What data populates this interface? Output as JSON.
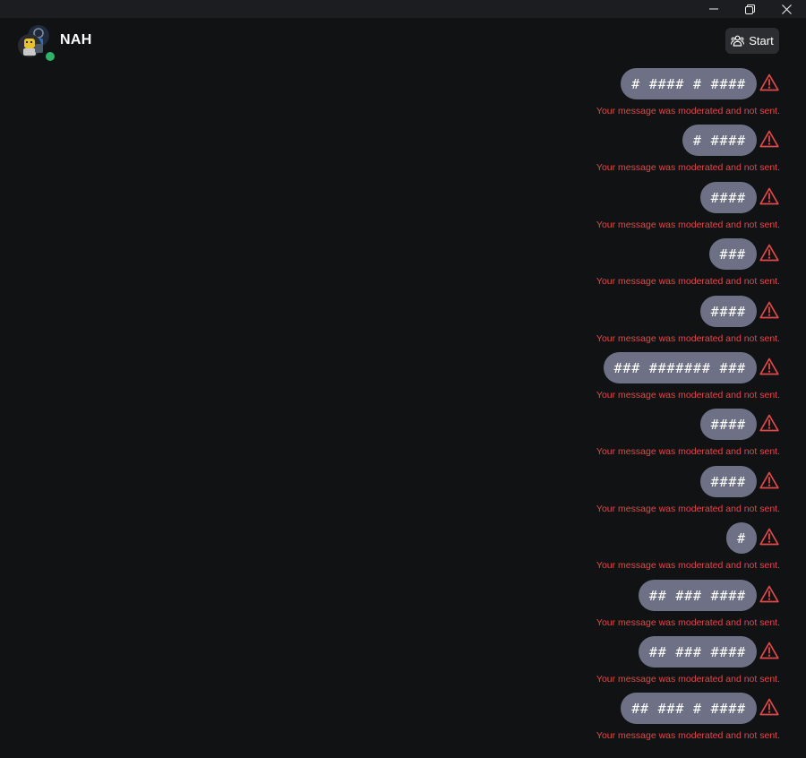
{
  "titlebar": {
    "minimize_icon": "minimize-icon",
    "restore_icon": "restore-icon",
    "close_icon": "close-icon"
  },
  "header": {
    "title": "NAH",
    "online_status_color": "#2fb36a",
    "start_button_label": "Start",
    "start_button_icon": "people-icon"
  },
  "messages": [
    {
      "text": "# #### # ####",
      "status": "Your message was moderated and not sent."
    },
    {
      "text": "# ####",
      "status": "Your message was moderated and not sent."
    },
    {
      "text": "####",
      "status": "Your message was moderated and not sent."
    },
    {
      "text": "###",
      "status": "Your message was moderated and not sent."
    },
    {
      "text": "####",
      "status": "Your message was moderated and not sent."
    },
    {
      "text": "### ####### ###",
      "status": "Your message was moderated and not sent."
    },
    {
      "text": "####",
      "status": "Your message was moderated and not sent."
    },
    {
      "text": "####",
      "status": "Your message was moderated and not sent."
    },
    {
      "text": "#",
      "status": "Your message was moderated and not sent."
    },
    {
      "text": "## ### ####",
      "status": "Your message was moderated and not sent."
    },
    {
      "text": "## ### ####",
      "status": "Your message was moderated and not sent."
    },
    {
      "text": "## ### # ####",
      "status": "Your message was moderated and not sent."
    }
  ],
  "colors": {
    "background": "#111214",
    "bubble": "#6e7185",
    "warning": "#e04a4a"
  }
}
